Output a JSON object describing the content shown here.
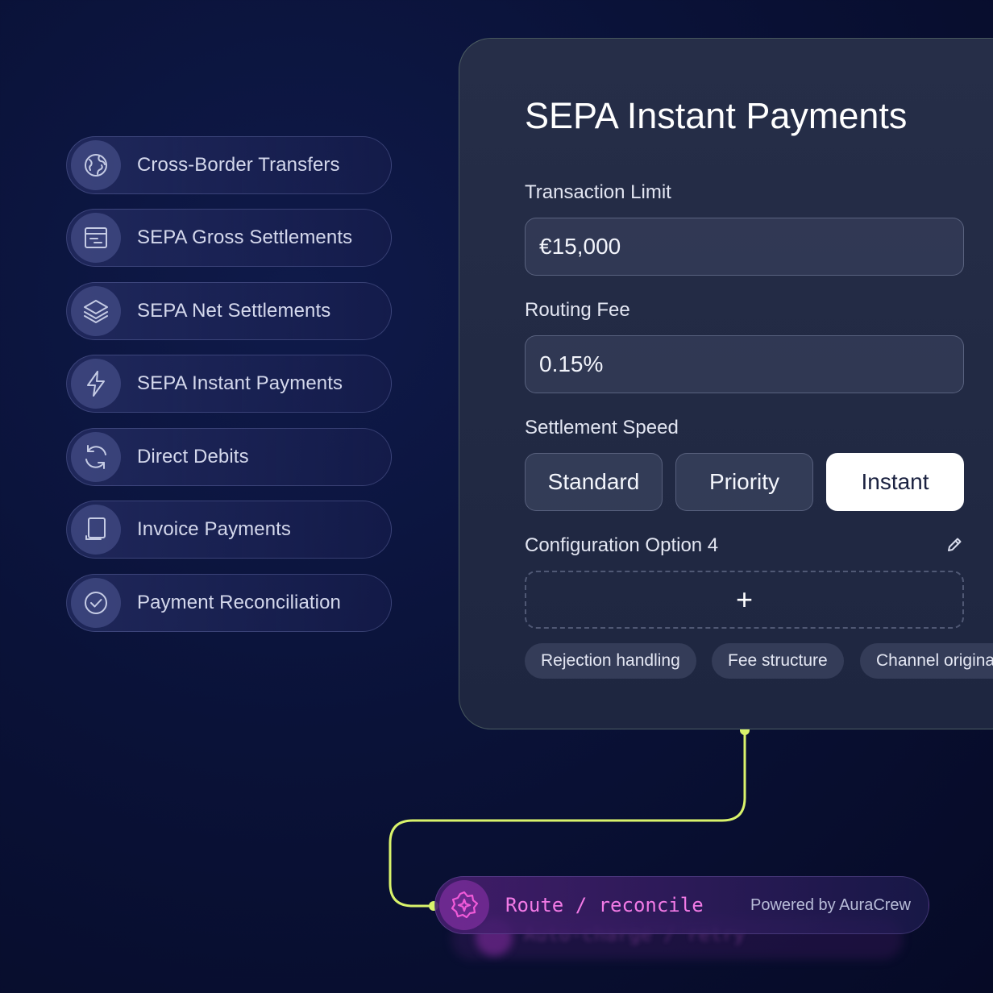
{
  "sidebar": {
    "items": [
      {
        "label": "Cross-Border Transfers",
        "icon": "globe-icon"
      },
      {
        "label": "SEPA Gross Settlements",
        "icon": "archive-icon"
      },
      {
        "label": "SEPA Net Settlements",
        "icon": "layers-icon"
      },
      {
        "label": "SEPA Instant Payments",
        "icon": "lightning-icon"
      },
      {
        "label": "Direct Debits",
        "icon": "refresh-icon"
      },
      {
        "label": "Invoice Payments",
        "icon": "document-icon"
      },
      {
        "label": "Payment Reconciliation",
        "icon": "check-circle-icon"
      }
    ]
  },
  "card": {
    "title": "SEPA Instant Payments",
    "transaction_limit": {
      "label": "Transaction Limit",
      "value": "€15,000"
    },
    "routing_fee": {
      "label": "Routing Fee",
      "value": "0.15%"
    },
    "settlement_speed": {
      "label": "Settlement Speed",
      "options": [
        "Standard",
        "Priority",
        "Instant"
      ],
      "selected": "Instant"
    },
    "config_option": {
      "label": "Configuration Option 4",
      "add_symbol": "+"
    },
    "chips": [
      "Rejection handling",
      "Fee structure",
      "Channel origina"
    ]
  },
  "route": {
    "text": "Route / reconcile",
    "powered_by": "Powered by AuraCrew",
    "ghost_text": "Auto-charge / retry"
  },
  "colors": {
    "accent_line": "#d9f36b",
    "route_magenta": "#f05ad8"
  }
}
